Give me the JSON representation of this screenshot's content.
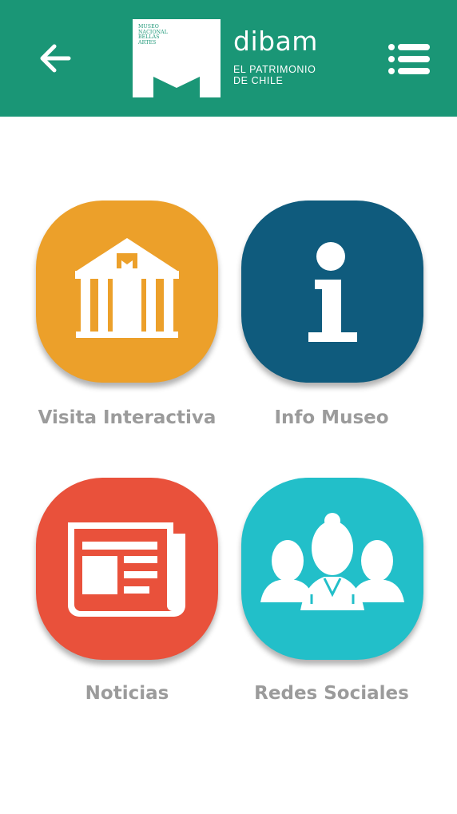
{
  "header": {
    "background_color": "#1a9676",
    "back_icon": "arrow-left-icon",
    "menu_icon": "list-menu-icon",
    "logo": {
      "museum_line_1": "MUSEO",
      "museum_line_2": "NACIONAL",
      "museum_line_3": "BELLAS",
      "museum_line_4": "ARTES",
      "brand": "dibam",
      "tagline": "EL PATRIMONIO DE CHILE"
    }
  },
  "tiles": [
    {
      "label": "Visita Interactiva",
      "color": "#eca02a",
      "icon": "museum-building-icon"
    },
    {
      "label": "Info Museo",
      "color": "#0f5b7d",
      "icon": "info-icon"
    },
    {
      "label": "Noticias",
      "color": "#e9513b",
      "icon": "newspaper-icon"
    },
    {
      "label": "Redes Sociales",
      "color": "#22bfc9",
      "icon": "people-group-icon"
    }
  ]
}
